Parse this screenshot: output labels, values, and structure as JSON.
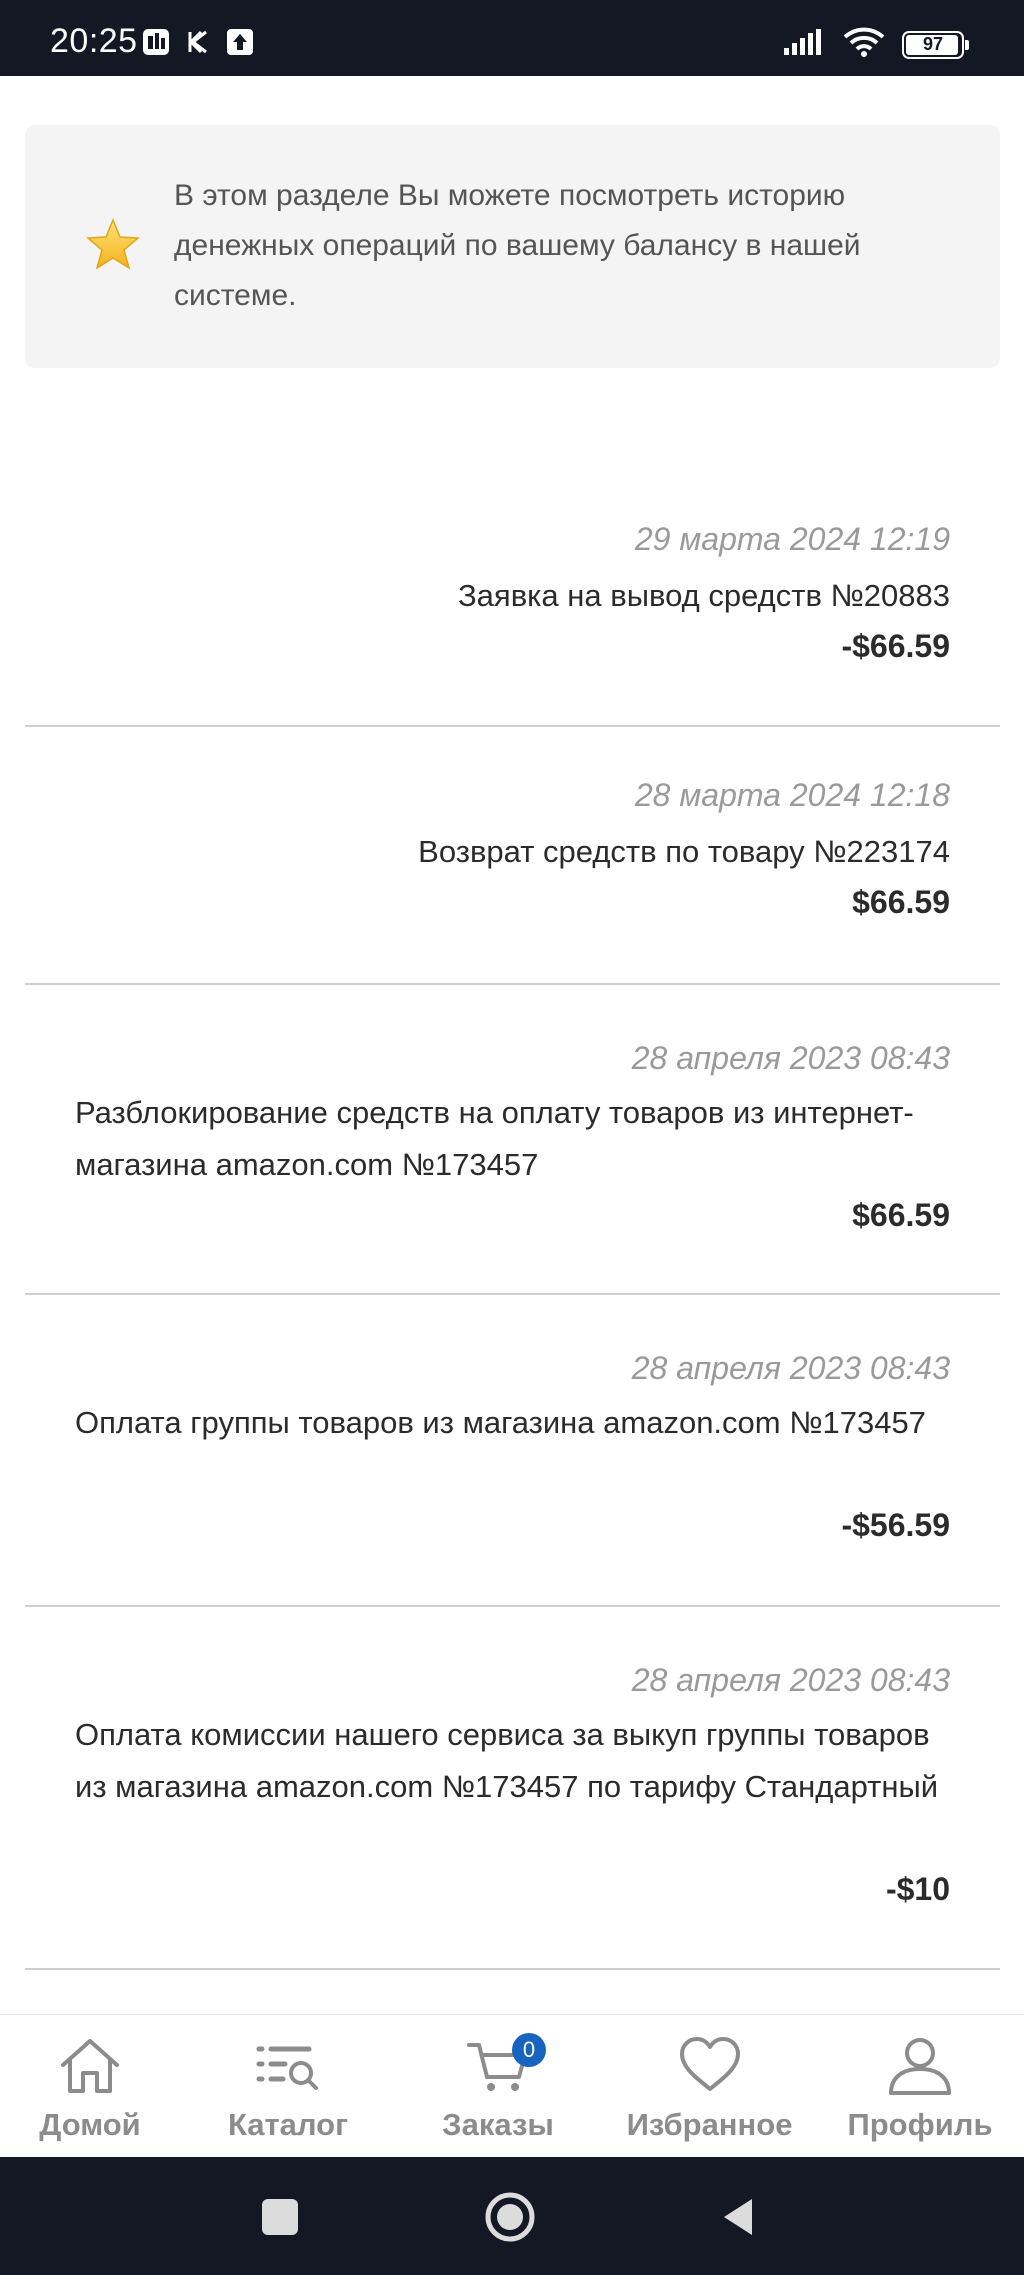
{
  "status_bar": {
    "time": "20:25",
    "battery": "97",
    "icons": [
      "gallery-icon",
      "k-app-icon",
      "upload-icon",
      "signal-icon",
      "wifi-icon",
      "battery-icon"
    ]
  },
  "info_box": {
    "icon": "star-icon",
    "text": "В этом разделе Вы можете посмотреть историю денежных операций по вашему балансу в нашей системе."
  },
  "transactions": [
    {
      "date": "29 марта 2024 12:19",
      "description": "Заявка на вывод средств №20883",
      "amount": "-$66.59"
    },
    {
      "date": "28 марта 2024 12:18",
      "description": "Возврат средств по товару №223174",
      "amount": "$66.59"
    },
    {
      "date": "28 апреля 2023 08:43",
      "description": "Разблокирование средств на оплату товаров из интернет-магазина amazon.com №173457",
      "amount": "$66.59"
    },
    {
      "date": "28 апреля 2023 08:43",
      "description": "Оплата группы товаров из магазина amazon.com №173457",
      "amount": "-$56.59"
    },
    {
      "date": "28 апреля 2023 08:43",
      "description": "Оплата комиссии нашего сервиса за выкуп группы товаров из магазина amazon.com №173457 по тарифу Стандартный",
      "amount": "-$10"
    }
  ],
  "bottom_nav": {
    "items": [
      {
        "label": "Домой",
        "icon": "home-icon"
      },
      {
        "label": "Каталог",
        "icon": "catalog-icon"
      },
      {
        "label": "Заказы",
        "icon": "cart-icon",
        "badge": "0"
      },
      {
        "label": "Избранное",
        "icon": "heart-icon"
      },
      {
        "label": "Профиль",
        "icon": "profile-icon"
      }
    ]
  },
  "colors": {
    "status_bar_bg": "#141824",
    "badge": "#1664c0",
    "nav_text": "#8c8c8c",
    "date_text": "#9a9a9a"
  }
}
